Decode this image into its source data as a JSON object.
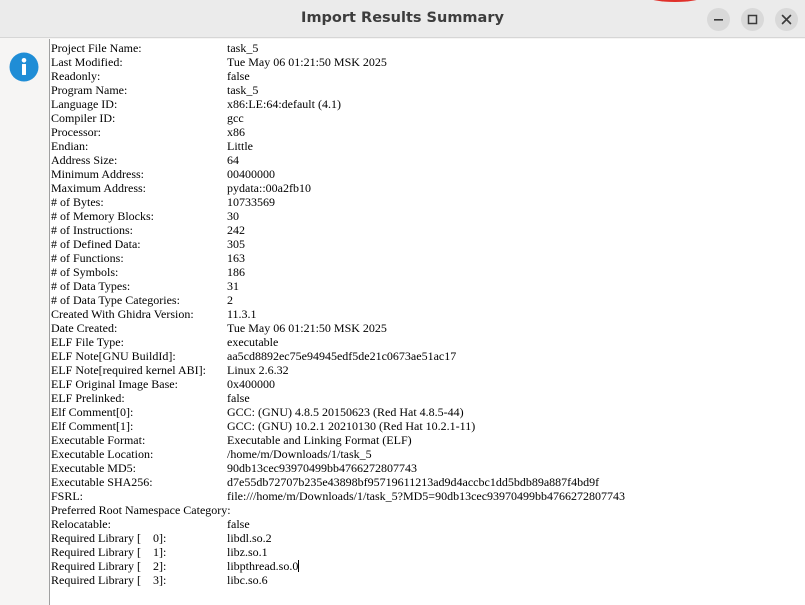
{
  "window": {
    "title": "Import Results Summary",
    "icon": "info-icon",
    "accent_color": "#1f8dd6"
  },
  "controls": {
    "minimize_icon": "minimize-icon",
    "maximize_icon": "maximize-icon",
    "close_icon": "close-icon"
  },
  "summary": [
    {
      "key": "Project File Name:",
      "value": "task_5"
    },
    {
      "key": "Last Modified:",
      "value": "Tue May 06 01:21:50 MSK 2025"
    },
    {
      "key": "Readonly:",
      "value": "false"
    },
    {
      "key": "Program Name:",
      "value": "task_5"
    },
    {
      "key": "Language ID:",
      "value": "x86:LE:64:default (4.1)"
    },
    {
      "key": "Compiler ID:",
      "value": "gcc"
    },
    {
      "key": "Processor:",
      "value": "x86"
    },
    {
      "key": "Endian:",
      "value": "Little"
    },
    {
      "key": "Address Size:",
      "value": "64"
    },
    {
      "key": "Minimum Address:",
      "value": "00400000"
    },
    {
      "key": "Maximum Address:",
      "value": "pydata::00a2fb10"
    },
    {
      "key": "# of Bytes:",
      "value": "10733569"
    },
    {
      "key": "# of Memory Blocks:",
      "value": "30"
    },
    {
      "key": "# of Instructions:",
      "value": "242"
    },
    {
      "key": "# of Defined Data:",
      "value": "305"
    },
    {
      "key": "# of Functions:",
      "value": "163"
    },
    {
      "key": "# of Symbols:",
      "value": "186"
    },
    {
      "key": "# of Data Types:",
      "value": "31"
    },
    {
      "key": "# of Data Type Categories:",
      "value": "2"
    },
    {
      "key": "Created With Ghidra Version:",
      "value": "11.3.1"
    },
    {
      "key": "Date Created:",
      "value": "Tue May 06 01:21:50 MSK 2025"
    },
    {
      "key": "ELF File Type:",
      "value": "executable"
    },
    {
      "key": "ELF Note[GNU BuildId]:",
      "value": "aa5cd8892ec75e94945edf5de21c0673ae51ac17"
    },
    {
      "key": "ELF Note[required kernel ABI]:",
      "value": "Linux 2.6.32"
    },
    {
      "key": "ELF Original Image Base:",
      "value": "0x400000"
    },
    {
      "key": "ELF Prelinked:",
      "value": "false"
    },
    {
      "key": "Elf Comment[0]:",
      "value": "GCC: (GNU) 4.8.5 20150623 (Red Hat 4.8.5-44)"
    },
    {
      "key": "Elf Comment[1]:",
      "value": "GCC: (GNU) 10.2.1 20210130 (Red Hat 10.2.1-11)"
    },
    {
      "key": "Executable Format:",
      "value": "Executable and Linking Format (ELF)"
    },
    {
      "key": "Executable Location:",
      "value": "/home/m/Downloads/1/task_5"
    },
    {
      "key": "Executable MD5:",
      "value": "90db13cec93970499bb4766272807743"
    },
    {
      "key": "Executable SHA256:",
      "value": "d7e55db72707b235e43898bf95719611213ad9d4accbc1dd5bdb89a887f4bd9f"
    },
    {
      "key": "FSRL:",
      "value": "file:///home/m/Downloads/1/task_5?MD5=90db13cec93970499bb4766272807743"
    },
    {
      "key": "Preferred Root Namespace Category:",
      "value": ""
    },
    {
      "key": "Relocatable:",
      "value": "false"
    },
    {
      "key": "Required Library [    0]:",
      "value": "libdl.so.2"
    },
    {
      "key": "Required Library [    1]:",
      "value": "libz.so.1"
    },
    {
      "key": "Required Library [    2]:",
      "value": "libpthread.so.0"
    },
    {
      "key": "Required Library [    3]:",
      "value": "libc.so.6"
    }
  ]
}
